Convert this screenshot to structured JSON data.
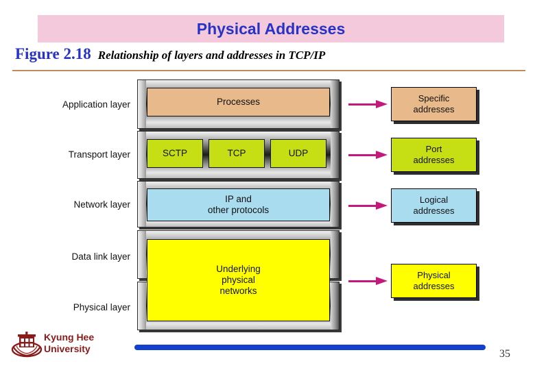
{
  "slide": {
    "title": "Physical Addresses",
    "title_bg_color": "#f3c9db",
    "title_color": "#2633c4",
    "page_number": "35"
  },
  "caption": {
    "figure_label": "Figure 2.18",
    "figure_title": "Relationship of layers and addresses in TCP/IP",
    "rule_color": "#c08a5a"
  },
  "diagram": {
    "layers": [
      {
        "label": "Application layer"
      },
      {
        "label": "Transport layer"
      },
      {
        "label": "Network layer"
      },
      {
        "label": "Data link layer"
      },
      {
        "label": "Physical layer"
      }
    ],
    "protocol_boxes": [
      {
        "name": "processes-box",
        "text": "Processes",
        "color": "#e8b98a"
      },
      {
        "name": "sctp-box",
        "text": "SCTP",
        "color": "#c6de14"
      },
      {
        "name": "tcp-box",
        "text": "TCP",
        "color": "#c6de14"
      },
      {
        "name": "udp-box",
        "text": "UDP",
        "color": "#c6de14"
      },
      {
        "name": "ip-box",
        "text": "IP and\nother protocols",
        "color": "#a9dcef"
      },
      {
        "name": "underlying-box",
        "text": "Underlying\nphysical\nnetworks",
        "color": "#ffff00"
      }
    ],
    "address_boxes": [
      {
        "name": "specific-addresses-box",
        "text": "Specific\naddresses",
        "color": "#e8b98a"
      },
      {
        "name": "port-addresses-box",
        "text": "Port\naddresses",
        "color": "#c6de14"
      },
      {
        "name": "logical-addresses-box",
        "text": "Logical\naddresses",
        "color": "#a9dcef"
      },
      {
        "name": "physical-addresses-box",
        "text": "Physical\naddresses",
        "color": "#ffff00"
      }
    ],
    "arrow_color": "#c4197c"
  },
  "footer": {
    "university_name": "Kyung Hee\nUniversity",
    "logo_color": "#8b1a1a",
    "accent_bar_color": "#1340cc"
  }
}
